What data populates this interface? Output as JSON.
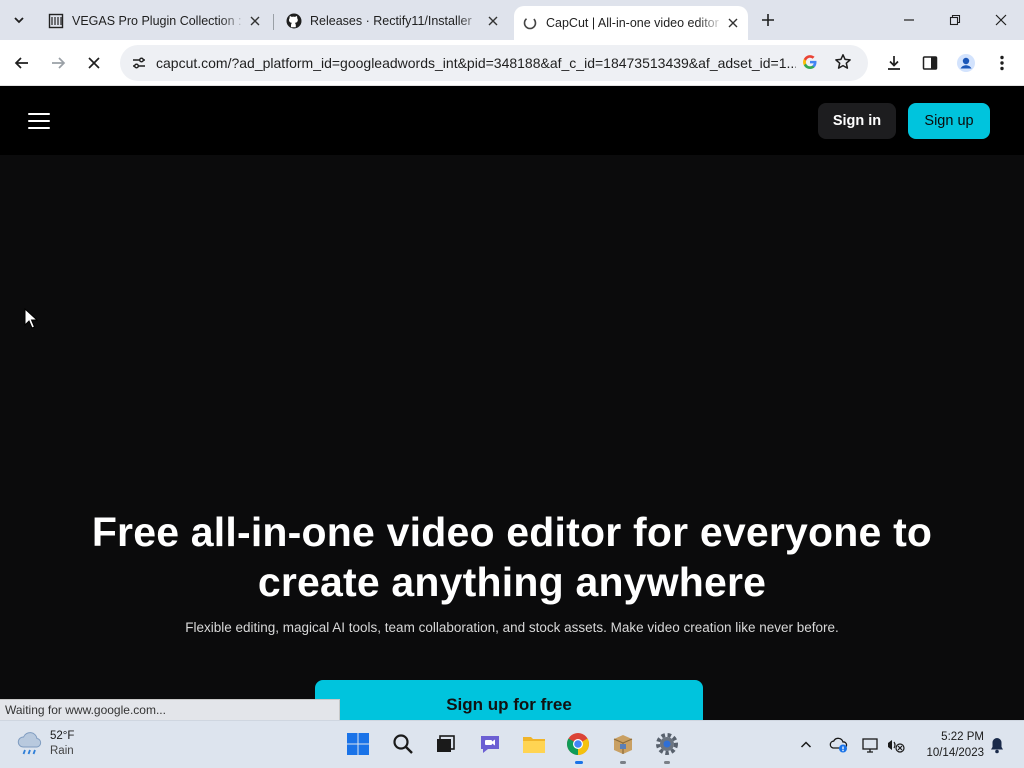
{
  "browser": {
    "tabs": [
      {
        "title": "VEGAS Pro Plugin Collection : ",
        "icon": "museum-icon"
      },
      {
        "title": "Releases · Rectify11/Installer",
        "icon": "github-icon"
      },
      {
        "title": "CapCut | All-in-one video editor",
        "icon": "capcut-icon",
        "active": true
      }
    ],
    "url": "capcut.com/?ad_platform_id=googleadwords_int&pid=348188&af_c_id=18473513439&af_adset_id=1...",
    "status_text": "Waiting for www.google.com..."
  },
  "page": {
    "header": {
      "signin_label": "Sign in",
      "signup_label": "Sign up"
    },
    "hero": {
      "title_line1": "Free all-in-one video editor for everyone to",
      "title_line2": "create anything anywhere",
      "subtitle": "Flexible editing, magical AI tools, team collaboration, and stock assets. Make video creation like never before.",
      "cta_label": "Sign up for free"
    },
    "colors": {
      "accent": "#00c4dd",
      "background": "#0b0b0c"
    }
  },
  "taskbar": {
    "weather_temp": "52°F",
    "weather_cond": "Rain",
    "time": "5:22 PM",
    "date": "10/14/2023"
  }
}
